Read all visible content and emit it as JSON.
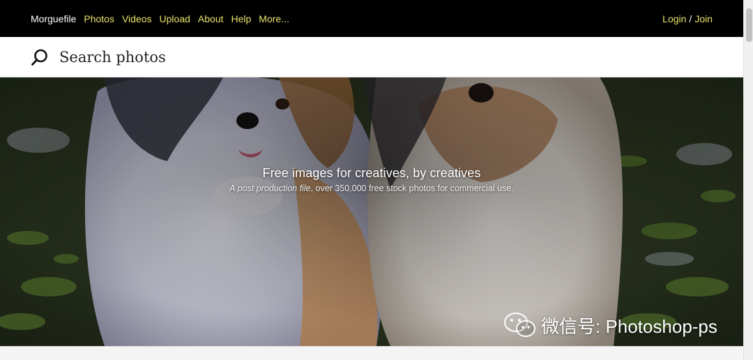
{
  "nav": {
    "brand": "Morguefile",
    "links": [
      "Photos",
      "Videos",
      "Upload",
      "About",
      "Help",
      "More..."
    ],
    "login": "Login",
    "separator": "/",
    "join": "Join"
  },
  "search": {
    "placeholder": "Search photos",
    "icon": "search-icon"
  },
  "hero": {
    "title": "Free images for creatives, by creatives",
    "subtitle_italic": "A post production file",
    "subtitle_rest": ", over 350,000 free stock photos for commercial use."
  },
  "watermark": {
    "text": "微信号: Photoshop-ps",
    "icon": "wechat-icon"
  },
  "colors": {
    "nav_bg": "#000000",
    "nav_link": "#e8e46a",
    "brand": "#ffffff"
  }
}
